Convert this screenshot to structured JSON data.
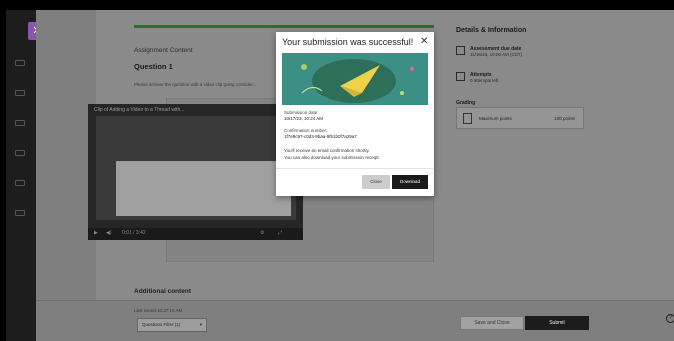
{
  "main": {
    "section_title": "Assignment Content",
    "question_label": "Question 1",
    "prompt": "Please answer the question with a video clip going consider...",
    "video_title": "Clip of Adding a Video to a Thread with...",
    "video_time": "0:01 / 3:42",
    "additional_title": "Additional content",
    "last_saved": "Last saved 10:27:16 AM",
    "question_filter": "Questions Filter (1)"
  },
  "right": {
    "title": "Details & Information",
    "due_label": "Assessment due date",
    "due_value": "11/16/23, 10:00 AM (CST)",
    "attempts_label": "Attempts",
    "attempts_value": "0 attempts left",
    "grading_label": "Grading",
    "max_points_label": "Maximum points",
    "max_points_value": "100 points"
  },
  "footer": {
    "save_close": "Save and Close",
    "submit": "Submit"
  },
  "modal": {
    "title": "Your submission was successful!",
    "submission_date_label": "Submission date:",
    "submission_date": "10/17/23, 10:24 AM",
    "confirmation_label": "Confirmation number:",
    "confirmation_number": "1f7e9c97-c0d3-9baa-9f51b0f7a29a7",
    "email_note": "You'll receive an email confirmation shortly.",
    "download_note": "You can also download your submission receipt",
    "close": "Close",
    "download": "Download"
  },
  "colors": {
    "banner": "#3b8f85",
    "progress": "#2b6e2e",
    "brand": "#8a55b5"
  }
}
